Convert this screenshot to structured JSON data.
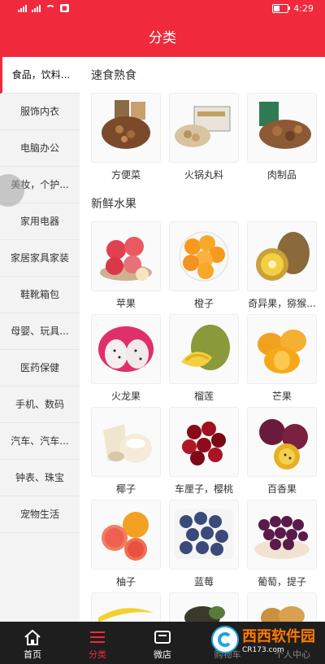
{
  "statusbar": {
    "time": "4:29",
    "battery_level": 0.35,
    "battery_label": "31"
  },
  "header": {
    "title": "分类"
  },
  "sidebar": {
    "items": [
      {
        "label": "食品，饮料..."
      },
      {
        "label": "服饰内衣"
      },
      {
        "label": "电脑办公"
      },
      {
        "label": "美妆，个护..."
      },
      {
        "label": "家用电器"
      },
      {
        "label": "家居家具家装"
      },
      {
        "label": "鞋靴箱包"
      },
      {
        "label": "母婴、玩具..."
      },
      {
        "label": "医药保健"
      },
      {
        "label": "手机、数码"
      },
      {
        "label": "汽车、汽车..."
      },
      {
        "label": "钟表、珠宝"
      },
      {
        "label": "宠物生活"
      }
    ]
  },
  "sections": [
    {
      "title": "速食熟食",
      "items": [
        {
          "label": "方便菜",
          "icon": "nuts-image"
        },
        {
          "label": "火锅丸料",
          "icon": "box-image"
        },
        {
          "label": "肉制品",
          "icon": "nut-pack-image"
        }
      ]
    },
    {
      "title": "新鲜水果",
      "items": [
        {
          "label": "苹果",
          "icon": "apple-image"
        },
        {
          "label": "橙子",
          "icon": "orange-image"
        },
        {
          "label": "奇异果，猕猴...",
          "icon": "kiwi-image"
        },
        {
          "label": "火龙果",
          "icon": "dragonfruit-image"
        },
        {
          "label": "榴莲",
          "icon": "durian-image"
        },
        {
          "label": "芒果",
          "icon": "mango-image"
        },
        {
          "label": "椰子",
          "icon": "coconut-image"
        },
        {
          "label": "车厘子，樱桃",
          "icon": "cherry-image"
        },
        {
          "label": "百香果",
          "icon": "passionfruit-image"
        },
        {
          "label": "柚子",
          "icon": "grapefruit-image"
        },
        {
          "label": "蓝莓",
          "icon": "blueberry-image"
        },
        {
          "label": "葡萄，提子",
          "icon": "grape-image"
        },
        {
          "label": "",
          "icon": "banana-image"
        },
        {
          "label": "",
          "icon": "avocado-image"
        },
        {
          "label": "",
          "icon": "pear-image"
        }
      ]
    }
  ],
  "tabbar": {
    "items": [
      {
        "label": "首页",
        "icon": "home-icon"
      },
      {
        "label": "分类",
        "icon": "menu-icon"
      },
      {
        "label": "微店",
        "icon": "shop-icon"
      },
      {
        "label": "购物车",
        "icon": "cart-icon"
      },
      {
        "label": "个人中心",
        "icon": "user-icon"
      }
    ]
  },
  "watermark": {
    "text": "西西软件园",
    "url": "CR173.com"
  },
  "colors": {
    "accent": "#f02a3c",
    "tabbar": "#1e1e1e"
  }
}
